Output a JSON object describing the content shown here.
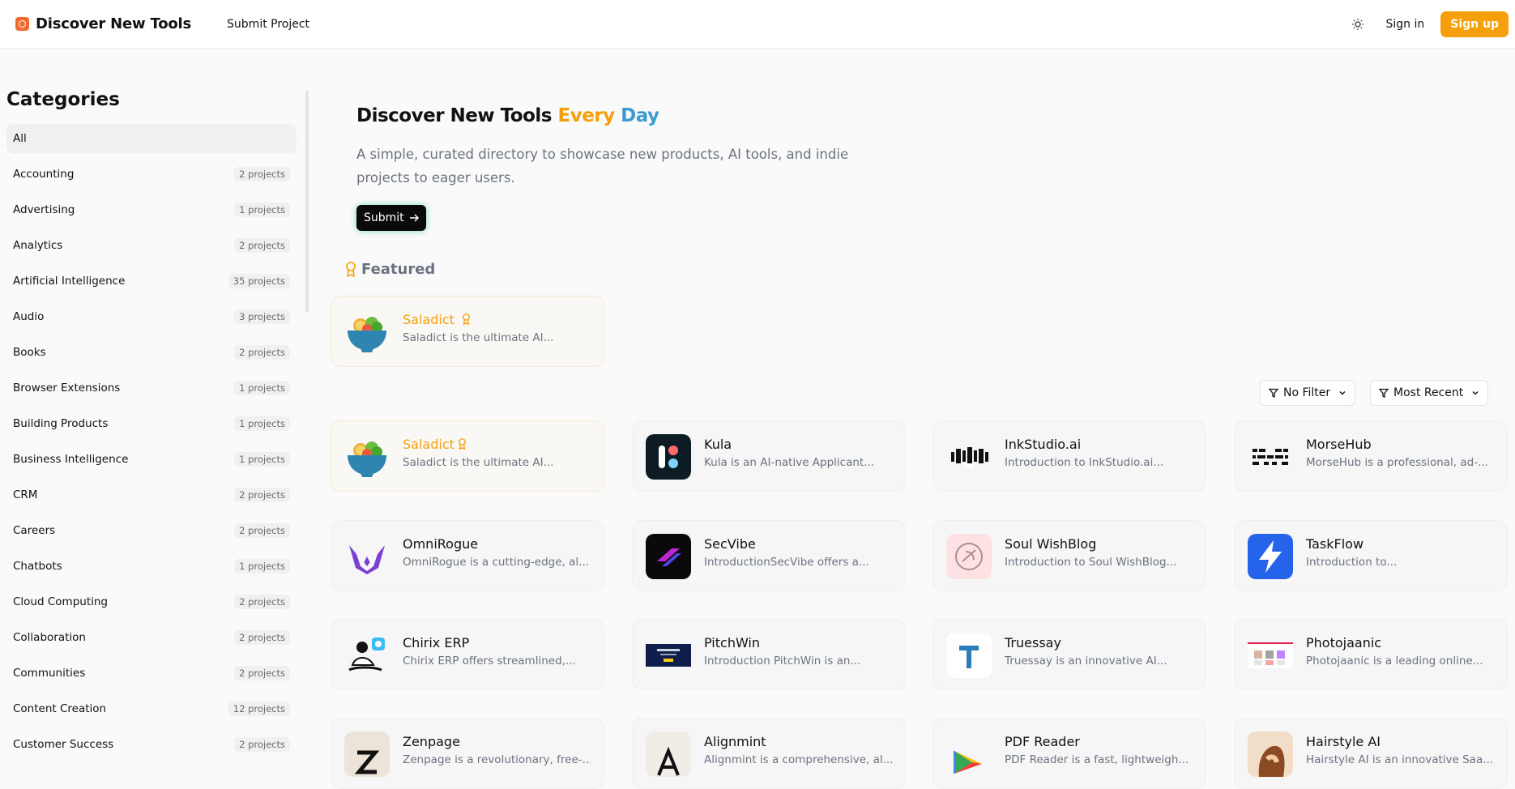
{
  "header": {
    "logo_text": "Discover New Tools",
    "nav_submit": "Submit Project",
    "signin": "Sign in",
    "signup": "Sign up"
  },
  "sidebar": {
    "title": "Categories",
    "items": [
      {
        "label": "All",
        "count": ""
      },
      {
        "label": "Accounting",
        "count": "2 projects"
      },
      {
        "label": "Advertising",
        "count": "1 projects"
      },
      {
        "label": "Analytics",
        "count": "2 projects"
      },
      {
        "label": "Artificial Intelligence",
        "count": "35 projects"
      },
      {
        "label": "Audio",
        "count": "3 projects"
      },
      {
        "label": "Books",
        "count": "2 projects"
      },
      {
        "label": "Browser Extensions",
        "count": "1 projects"
      },
      {
        "label": "Building Products",
        "count": "1 projects"
      },
      {
        "label": "Business Intelligence",
        "count": "1 projects"
      },
      {
        "label": "CRM",
        "count": "2 projects"
      },
      {
        "label": "Careers",
        "count": "2 projects"
      },
      {
        "label": "Chatbots",
        "count": "1 projects"
      },
      {
        "label": "Cloud Computing",
        "count": "2 projects"
      },
      {
        "label": "Collaboration",
        "count": "2 projects"
      },
      {
        "label": "Communities",
        "count": "2 projects"
      },
      {
        "label": "Content Creation",
        "count": "12 projects"
      },
      {
        "label": "Customer Success",
        "count": "2 projects"
      }
    ]
  },
  "hero": {
    "title_main": "Discover New Tools",
    "title_every": "Every",
    "title_day": "Day",
    "subtitle": "A simple, curated directory to showcase new products, AI tools, and indie projects to eager users.",
    "submit_label": "Submit"
  },
  "featured": {
    "label": "Featured",
    "card": {
      "name": "Saladict",
      "desc": "Saladict is the ultimate AI...",
      "icon": "salad-bowl-icon"
    }
  },
  "filters": {
    "filter_label": "No Filter",
    "sort_label": "Most Recent"
  },
  "projects": [
    {
      "name": "Saladict",
      "desc": "Saladict is the ultimate AI...",
      "icon": "salad-bowl-icon",
      "featured": true
    },
    {
      "name": "Kula",
      "desc": "Kula is an AI-native Applicant...",
      "icon": "kula-logo-icon"
    },
    {
      "name": "InkStudio.ai",
      "desc": "Introduction to InkStudio.ai...",
      "icon": "inkstudio-logo-icon"
    },
    {
      "name": "MorseHub",
      "desc": "MorseHub is a professional, ad-...",
      "icon": "morsehub-logo-icon"
    },
    {
      "name": "OmniRogue",
      "desc": "OmniRogue is a cutting-edge, al...",
      "icon": "omnirogue-logo-icon"
    },
    {
      "name": "SecVibe",
      "desc": "IntroductionSecVibe offers a...",
      "icon": "secvibe-logo-icon"
    },
    {
      "name": "Soul WishBlog",
      "desc": "Introduction to Soul WishBlog...",
      "icon": "soul-wishblog-logo-icon"
    },
    {
      "name": "TaskFlow",
      "desc": "Introduction to...",
      "icon": "lightning-bolt-icon"
    },
    {
      "name": "Chirix ERP",
      "desc": "Chirix ERP offers streamlined,...",
      "icon": "chirix-illustration-icon"
    },
    {
      "name": "PitchWin",
      "desc": "Introduction PitchWin is an...",
      "icon": "pitchwin-screenshot-icon"
    },
    {
      "name": "Truessay",
      "desc": "Truessay is an innovative AI...",
      "icon": "truessay-logo-icon"
    },
    {
      "name": "Photojaanic",
      "desc": "Photojaanic is a leading online...",
      "icon": "photojaanic-screenshot-icon"
    },
    {
      "name": "Zenpage",
      "desc": "Zenpage is a revolutionary, free-...",
      "icon": "zenpage-logo-icon"
    },
    {
      "name": "Alignmint",
      "desc": "Alignmint is a comprehensive, al...",
      "icon": "alignmint-logo-icon"
    },
    {
      "name": "PDF Reader",
      "desc": "PDF Reader is a fast, lightweigh...",
      "icon": "play-triangle-icon"
    },
    {
      "name": "Hairstyle AI",
      "desc": "Hairstyle AI is an innovative Saa...",
      "icon": "hairstyle-photo-icon"
    }
  ]
}
